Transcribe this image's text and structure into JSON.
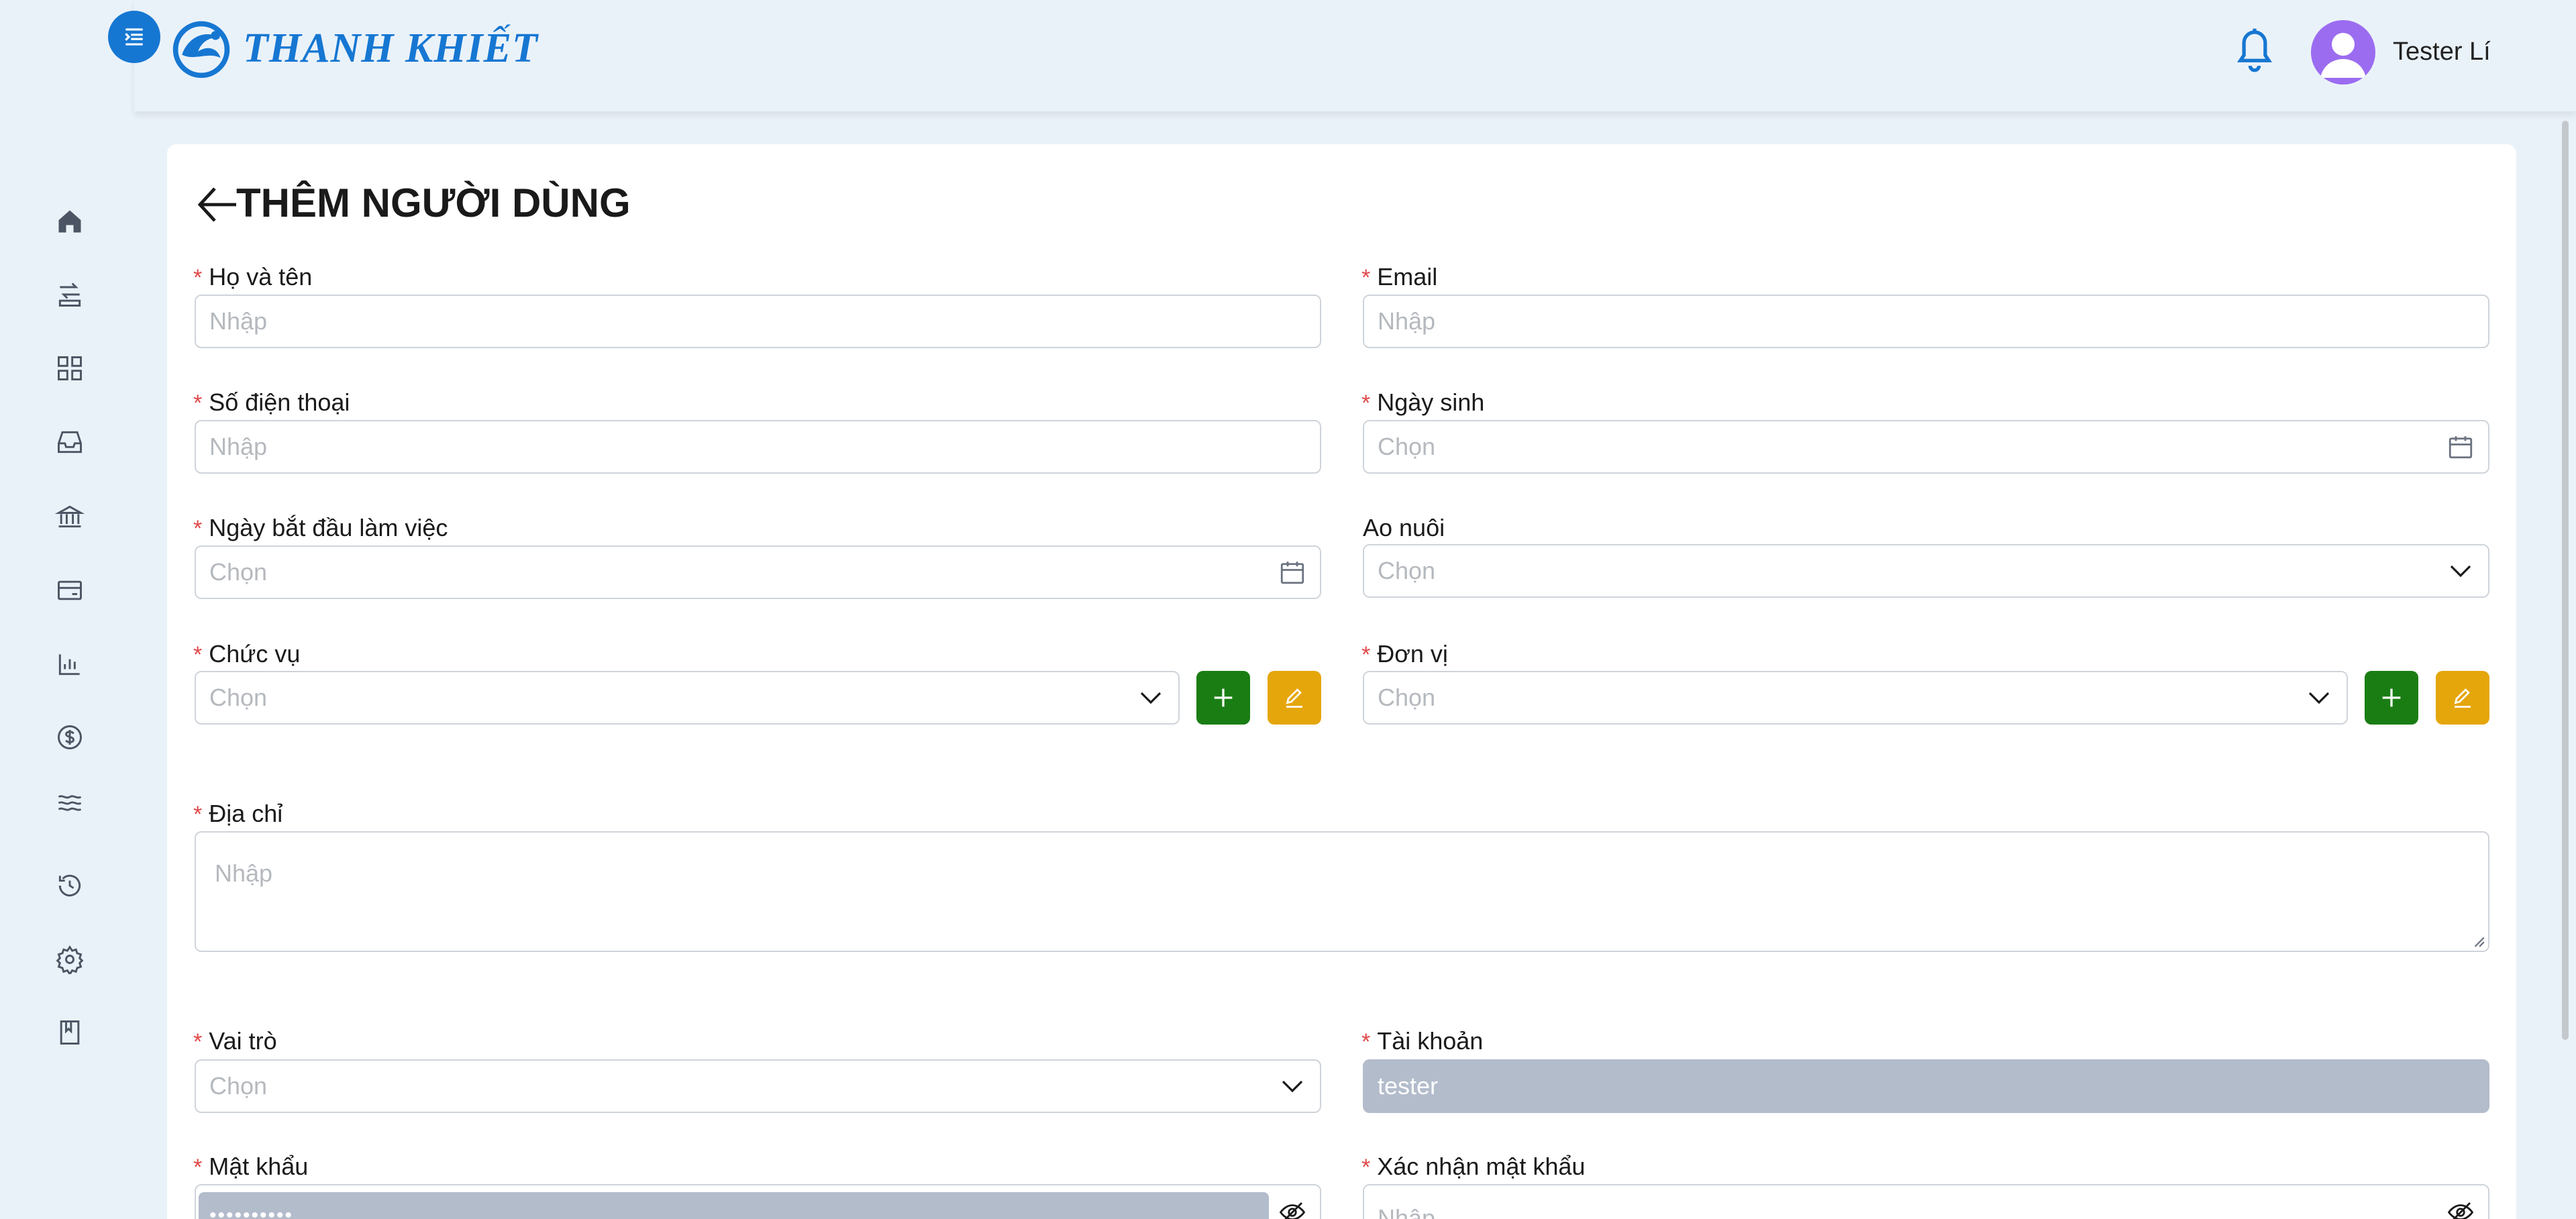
{
  "app": {
    "brand": "THANH KHIẾT",
    "user_name": "Tester Lí"
  },
  "page": {
    "title": "THÊM NGƯỜI DÙNG"
  },
  "sidebar": {
    "items": [
      {
        "icon": "home-icon"
      },
      {
        "icon": "transfer-icon"
      },
      {
        "icon": "grid-icon"
      },
      {
        "icon": "inbox-icon"
      },
      {
        "icon": "bank-icon"
      },
      {
        "icon": "card-icon"
      },
      {
        "icon": "bar-chart-icon"
      },
      {
        "icon": "dollar-icon"
      },
      {
        "icon": "waves-icon"
      },
      {
        "icon": "history-icon"
      },
      {
        "icon": "gear-icon"
      },
      {
        "icon": "book-icon"
      }
    ]
  },
  "form": {
    "full_name": {
      "label": "Họ và tên",
      "placeholder": "Nhập",
      "required": true
    },
    "email": {
      "label": "Email",
      "placeholder": "Nhập",
      "required": true
    },
    "phone": {
      "label": "Số điện thoại",
      "placeholder": "Nhập",
      "required": true
    },
    "birthday": {
      "label": "Ngày sinh",
      "placeholder": "Chọn",
      "required": true
    },
    "start_date": {
      "label": "Ngày bắt đầu làm việc",
      "placeholder": "Chọn",
      "required": true
    },
    "pond": {
      "label": "Ao nuôi",
      "placeholder": "Chọn",
      "required": false
    },
    "position": {
      "label": "Chức vụ",
      "placeholder": "Chọn",
      "required": true
    },
    "unit": {
      "label": "Đơn vị",
      "placeholder": "Chọn",
      "required": true
    },
    "address": {
      "label": "Địa chỉ",
      "placeholder": "Nhập",
      "required": true
    },
    "role": {
      "label": "Vai trò",
      "placeholder": "Chọn",
      "required": true
    },
    "account": {
      "label": "Tài khoản",
      "value": "tester",
      "required": true
    },
    "password": {
      "label": "Mật khẩu",
      "value": "••••••••••",
      "required": true
    },
    "confirm_password": {
      "label": "Xác nhận mật khẩu",
      "placeholder": "Nhập",
      "required": true
    }
  },
  "colors": {
    "primary": "#1677d2",
    "add_button": "#1a7d14",
    "edit_button": "#e5a60c",
    "required_star": "#e04848",
    "disabled_field": "#b3bccb"
  }
}
